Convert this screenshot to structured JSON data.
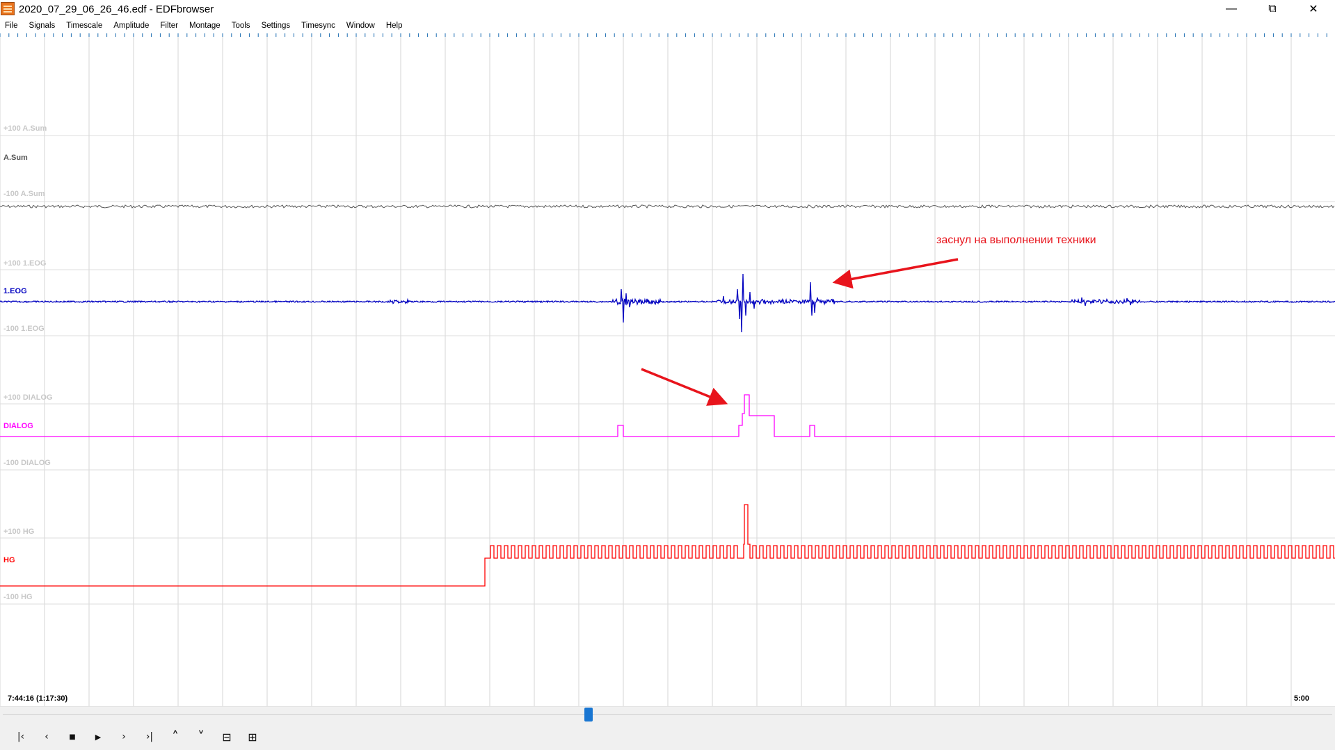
{
  "window": {
    "title": "2020_07_29_06_26_46.edf - EDFbrowser",
    "minimize_label": "—",
    "maximize_label": "⧉",
    "close_label": "✕"
  },
  "menu": [
    "File",
    "Signals",
    "Timescale",
    "Amplitude",
    "Filter",
    "Montage",
    "Tools",
    "Settings",
    "Timesync",
    "Window",
    "Help"
  ],
  "signals": [
    {
      "label": "A.Sum",
      "upper": "+100 A.Sum",
      "lower": "-100 A.Sum",
      "color": "#555555"
    },
    {
      "label": "1.EOG",
      "upper": "+100 1.EOG",
      "lower": "-100 1.EOG",
      "color": "#0000c0"
    },
    {
      "label": "DIALOG",
      "upper": "+100 DIALOG",
      "lower": "-100 DIALOG",
      "color": "#ff00ff"
    },
    {
      "label": "HG",
      "upper": "+100 HG",
      "lower": "-100 HG",
      "color": "#ff0000"
    }
  ],
  "annotation": {
    "text": "заснул на выполнении техники",
    "color": "#e8141c"
  },
  "time": {
    "position": "7:44:16 (1:17:30)",
    "page_span": "5:00"
  },
  "scroll": {
    "position_fraction": 0.44
  },
  "toolbar": {
    "buttons": [
      {
        "name": "go-start-icon",
        "glyph": "|‹"
      },
      {
        "name": "page-back-icon",
        "glyph": "‹"
      },
      {
        "name": "stop-icon",
        "glyph": "■"
      },
      {
        "name": "play-icon",
        "glyph": "▶"
      },
      {
        "name": "page-forward-icon",
        "glyph": "›"
      },
      {
        "name": "go-end-icon",
        "glyph": "›|"
      },
      {
        "name": "chevron-up-icon",
        "glyph": "˄"
      },
      {
        "name": "chevron-down-icon",
        "glyph": "˅"
      },
      {
        "name": "zoom-out-icon",
        "glyph": "⊟"
      },
      {
        "name": "zoom-in-icon",
        "glyph": "⊞"
      }
    ]
  }
}
